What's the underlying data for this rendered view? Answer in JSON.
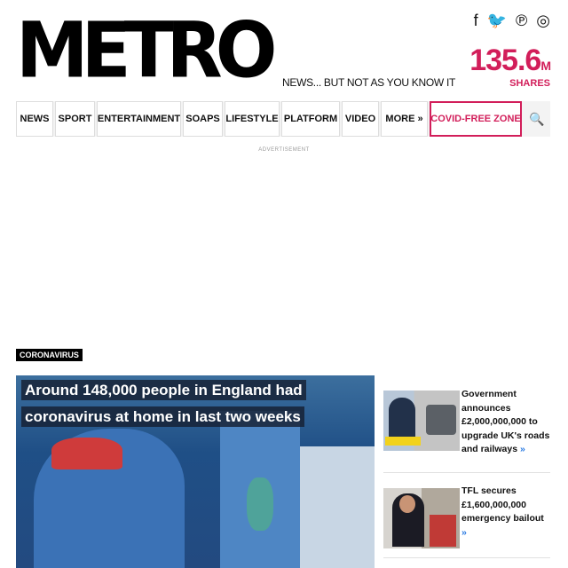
{
  "header": {
    "logo": "METRO",
    "tagline": "NEWS... BUT NOT AS YOU KNOW IT",
    "shares_number": "135.6",
    "shares_unit": "M",
    "shares_label": "SHARES",
    "social": [
      {
        "icon": "facebook-icon",
        "glyph": "f"
      },
      {
        "icon": "twitter-icon",
        "glyph": "🐦"
      },
      {
        "icon": "pinterest-icon",
        "glyph": "℗"
      },
      {
        "icon": "instagram-icon",
        "glyph": "◎"
      }
    ]
  },
  "nav": {
    "items": [
      "NEWS",
      "SPORT",
      "ENTERTAINMENT",
      "SOAPS",
      "LIFESTYLE",
      "PLATFORM",
      "VIDEO",
      "MORE »",
      "COVID-FREE ZONE"
    ],
    "search_icon": "search-icon",
    "search_glyph": "🔍"
  },
  "ad_label": "ADVERTISEMENT",
  "section_tag": "CORONAVIRUS",
  "main_story": {
    "headline": "Around 148,000 people in England had coronavirus at home in last two weeks"
  },
  "side_stories": [
    {
      "text": "Government announces £2,000,000,000 to upgrade UK's roads and railways",
      "arrow": "»"
    },
    {
      "text": "TFL secures £1,600,000,000 emergency bailout",
      "arrow": "»"
    }
  ],
  "colors": {
    "accent": "#d21e5a",
    "link_arrow": "#2a7ae2"
  }
}
